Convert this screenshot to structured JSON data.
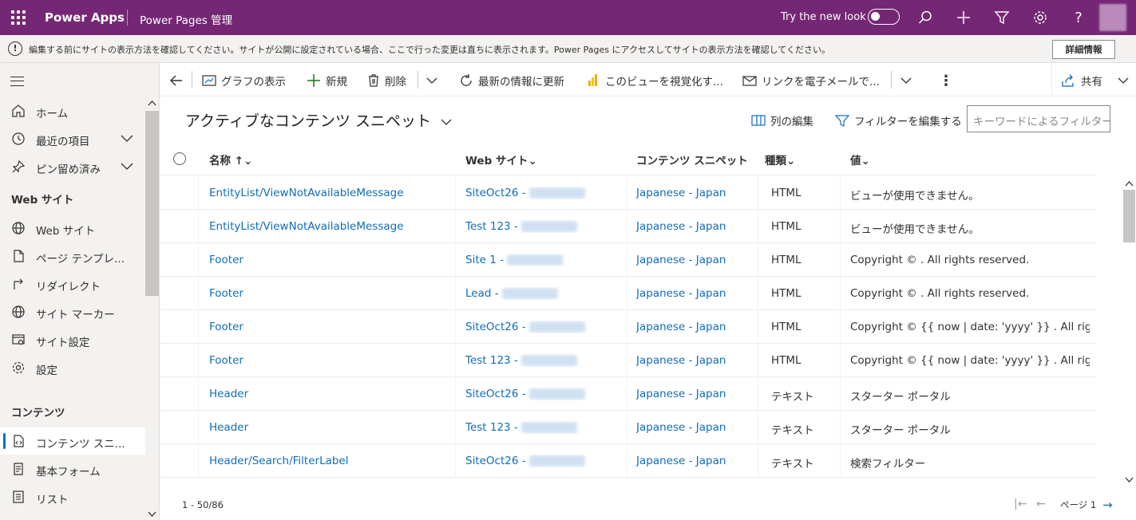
{
  "app": {
    "name": "Power Apps",
    "subtitle": "Power Pages 管理",
    "try_new_look": "Try the new look"
  },
  "banner": {
    "text": "編集する前にサイトの表示方法を確認してください。サイトが公開に設定されている場合、ここで行った変更は直ちに表示されます。Power Pages にアクセスしてサイトの表示方法を確認してください。",
    "button": "詳細情報"
  },
  "sidebar": {
    "items_top": [
      {
        "label": "ホーム",
        "icon": "home-icon"
      },
      {
        "label": "最近の項目",
        "icon": "clock-icon"
      },
      {
        "label": "ピン留め済み",
        "icon": "pin-icon"
      }
    ],
    "section_website": "Web サイト",
    "items_website": [
      {
        "label": "Web サイト",
        "icon": "globe-icon"
      },
      {
        "label": "ページ テンプレ...",
        "icon": "page-icon"
      },
      {
        "label": "リダイレクト",
        "icon": "redirect-icon"
      },
      {
        "label": "サイト マーカー",
        "icon": "globe-icon"
      },
      {
        "label": "サイト設定",
        "icon": "site-settings-icon"
      },
      {
        "label": "設定",
        "icon": "gear-icon"
      }
    ],
    "section_content": "コンテンツ",
    "items_content": [
      {
        "label": "コンテンツ スニ...",
        "icon": "snippet-icon"
      },
      {
        "label": "基本フォーム",
        "icon": "form-icon"
      },
      {
        "label": "リスト",
        "icon": "list-icon"
      }
    ]
  },
  "commandbar": {
    "show_chart": "グラフの表示",
    "new": "新規",
    "delete": "削除",
    "refresh": "最新の情報に更新",
    "visualize": "このビューを視覚化す...",
    "email_link": "リンクを電子メールで...",
    "share": "共有"
  },
  "view": {
    "title": "アクティブなコンテンツ スニペット",
    "edit_columns": "列の編集",
    "edit_filters": "フィルターを編集する",
    "search_placeholder": "キーワードによるフィルター"
  },
  "grid": {
    "columns": [
      "名称",
      "Web サイト",
      "コンテンツ スニペット...",
      "種類",
      "値"
    ],
    "rows": [
      {
        "name": "EntityList/ViewNotAvailableMessage",
        "site": "SiteOct26 -",
        "lang": "Japanese - Japan",
        "type": "HTML",
        "value": "ビューが使用できません。"
      },
      {
        "name": "EntityList/ViewNotAvailableMessage",
        "site": "Test 123 -",
        "lang": "Japanese - Japan",
        "type": "HTML",
        "value": "ビューが使用できません。"
      },
      {
        "name": "Footer",
        "site": "Site 1 -",
        "lang": "Japanese - Japan",
        "type": "HTML",
        "value": "Copyright © . All rights reserved."
      },
      {
        "name": "Footer",
        "site": "Lead -",
        "lang": "Japanese - Japan",
        "type": "HTML",
        "value": "Copyright © . All rights reserved."
      },
      {
        "name": "Footer",
        "site": "SiteOct26 -",
        "lang": "Japanese - Japan",
        "type": "HTML",
        "value": "Copyright ©  {{ now | date: 'yyyy' }} . All rights..."
      },
      {
        "name": "Footer",
        "site": "Test 123 -",
        "lang": "Japanese - Japan",
        "type": "HTML",
        "value": "Copyright ©  {{ now | date: 'yyyy' }} . All rights..."
      },
      {
        "name": "Header",
        "site": "SiteOct26 -",
        "lang": "Japanese - Japan",
        "type": "テキスト",
        "value": "スターター ポータル"
      },
      {
        "name": "Header",
        "site": "Test 123 -",
        "lang": "Japanese - Japan",
        "type": "テキスト",
        "value": "スターター ポータル"
      },
      {
        "name": "Header/Search/FilterLabel",
        "site": "SiteOct26 -",
        "lang": "Japanese - Japan",
        "type": "テキスト",
        "value": "検索フィルター"
      }
    ]
  },
  "footer": {
    "count": "1 - 50/86",
    "page": "ページ 1"
  },
  "colors": {
    "brand": "#742774",
    "link": "#0f6cbd"
  }
}
